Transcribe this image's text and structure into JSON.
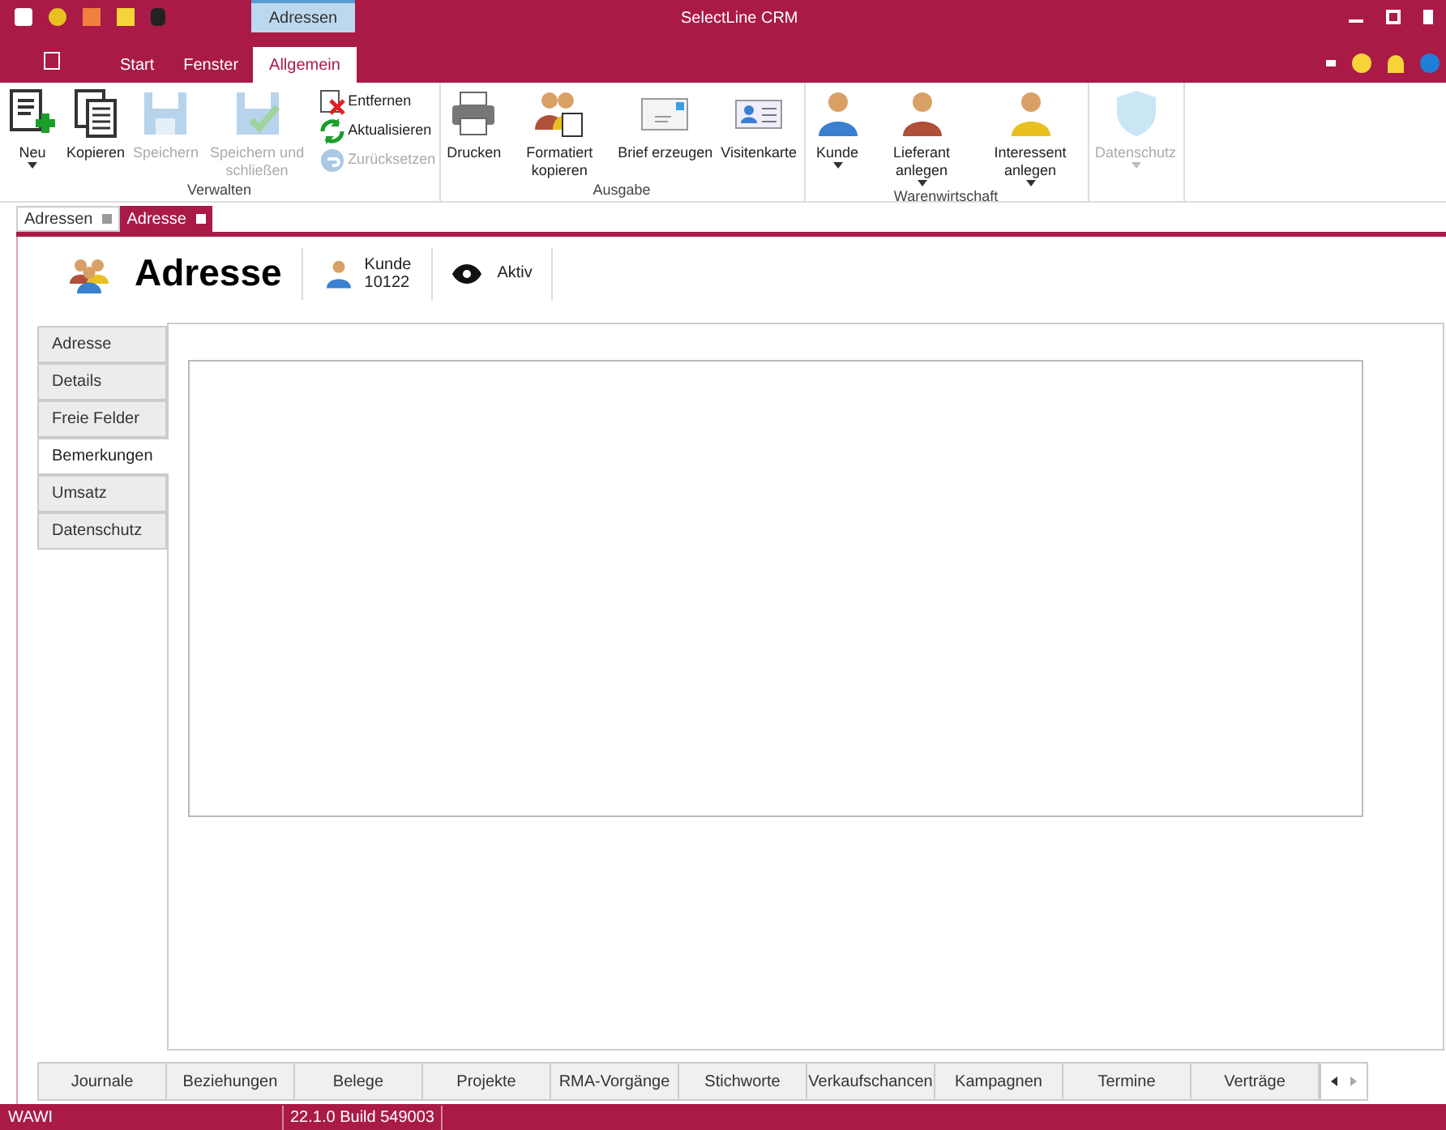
{
  "window": {
    "title": "SelectLine CRM",
    "context_tab": "Adressen"
  },
  "ribbon_tabs": [
    {
      "label": "Start",
      "selected": false
    },
    {
      "label": "Fenster",
      "selected": false
    },
    {
      "label": "Allgemein",
      "selected": true
    }
  ],
  "ribbon_groups": [
    {
      "label": "Verwalten",
      "buttons": [
        {
          "kind": "large",
          "label": "Neu",
          "dropdown": true,
          "disabled": false
        },
        {
          "kind": "large",
          "label": "Kopieren",
          "dropdown": false,
          "disabled": false
        },
        {
          "kind": "large",
          "label": "Speichern",
          "dropdown": false,
          "disabled": true
        },
        {
          "kind": "large",
          "label": "Speichern und schließen",
          "dropdown": false,
          "disabled": true
        },
        {
          "kind": "small",
          "label": "Entfernen",
          "disabled": false
        },
        {
          "kind": "small",
          "label": "Aktualisieren",
          "disabled": false
        },
        {
          "kind": "small",
          "label": "Zurücksetzen",
          "disabled": true
        }
      ]
    },
    {
      "label": "Ausgabe",
      "buttons": [
        {
          "kind": "large",
          "label": "Drucken",
          "dropdown": false,
          "disabled": false
        },
        {
          "kind": "large",
          "label": "Formatiert kopieren",
          "dropdown": false,
          "disabled": false
        },
        {
          "kind": "large",
          "label": "Brief erzeugen",
          "dropdown": false,
          "disabled": false
        },
        {
          "kind": "large",
          "label": "Visitenkarte",
          "dropdown": false,
          "disabled": false
        }
      ]
    },
    {
      "label": "Warenwirtschaft",
      "buttons": [
        {
          "kind": "large",
          "label": "Kunde",
          "dropdown": true,
          "disabled": false
        },
        {
          "kind": "large",
          "label": "Lieferant anlegen",
          "dropdown": true,
          "disabled": false
        },
        {
          "kind": "large",
          "label": "Interessent anlegen",
          "dropdown": true,
          "disabled": false
        }
      ]
    },
    {
      "buttons": [
        {
          "kind": "large",
          "label": "Datenschutz",
          "dropdown": true,
          "disabled": true
        }
      ]
    }
  ],
  "doc_tabs": [
    {
      "label": "Adressen",
      "selected": false
    },
    {
      "label": "Adresse",
      "selected": true
    }
  ],
  "header": {
    "title": "Adresse",
    "type_label": "Kunde",
    "number": "10122",
    "status": "Aktiv"
  },
  "side_tabs": [
    {
      "label": "Adresse",
      "selected": false
    },
    {
      "label": "Details",
      "selected": false
    },
    {
      "label": "Freie Felder",
      "selected": false
    },
    {
      "label": "Bemerkungen",
      "selected": true
    },
    {
      "label": "Umsatz",
      "selected": false
    },
    {
      "label": "Datenschutz",
      "selected": false
    }
  ],
  "bottom_tabs": [
    "Journale",
    "Beziehungen",
    "Belege",
    "Projekte",
    "RMA-Vorgänge",
    "Stichworte",
    "Verkaufschancen",
    "Kampagnen",
    "Termine",
    "Verträge"
  ],
  "status_bar": [
    "WAWI",
    "22.1.0 Build 549003"
  ]
}
